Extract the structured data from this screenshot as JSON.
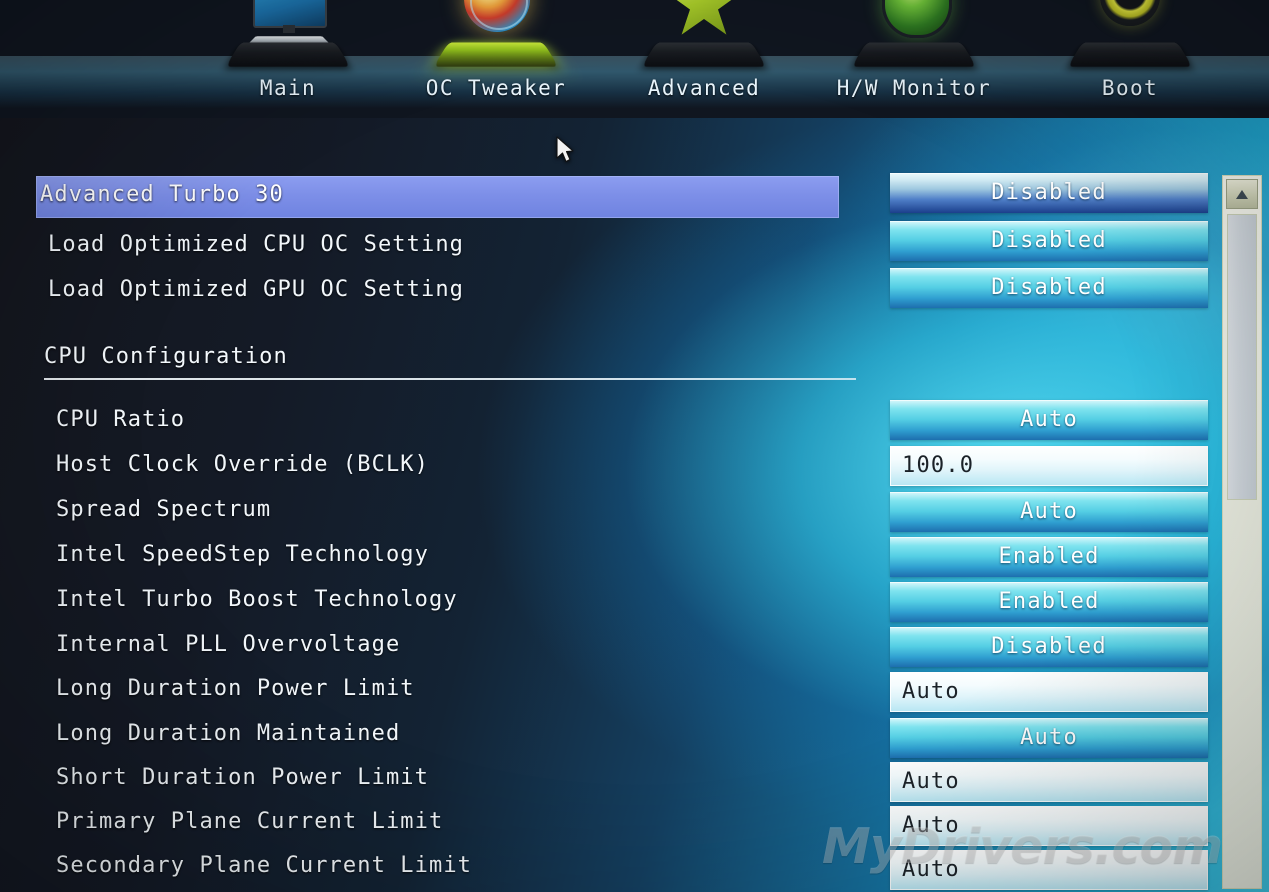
{
  "nav": {
    "tabs": [
      {
        "label": "Main",
        "icon": "monitor-icon",
        "active": false
      },
      {
        "label": "OC Tweaker",
        "icon": "orb-icon",
        "active": true
      },
      {
        "label": "Advanced",
        "icon": "star-icon",
        "active": false
      },
      {
        "label": "H/W Monitor",
        "icon": "gauge-icon",
        "active": false
      },
      {
        "label": "Boot",
        "icon": "power-ring-icon",
        "active": false
      }
    ]
  },
  "settings": [
    {
      "label": "Advanced Turbo 30",
      "value": "Disabled",
      "widget": "dropdown",
      "selected": true,
      "indent": false
    },
    {
      "label": "Load Optimized CPU OC Setting",
      "value": "Disabled",
      "widget": "dropdown",
      "selected": false,
      "indent": false
    },
    {
      "label": "Load Optimized GPU OC Setting",
      "value": "Disabled",
      "widget": "dropdown",
      "selected": false,
      "indent": false
    }
  ],
  "section": {
    "title": "CPU Configuration"
  },
  "cpu_settings": [
    {
      "label": "CPU Ratio",
      "value": "Auto",
      "widget": "dropdown"
    },
    {
      "label": "Host Clock Override (BCLK)",
      "value": "100.0",
      "widget": "input"
    },
    {
      "label": "Spread Spectrum",
      "value": "Auto",
      "widget": "dropdown"
    },
    {
      "label": "Intel SpeedStep Technology",
      "value": "Enabled",
      "widget": "dropdown"
    },
    {
      "label": "Intel Turbo Boost Technology",
      "value": "Enabled",
      "widget": "dropdown"
    },
    {
      "label": "Internal PLL Overvoltage",
      "value": "Disabled",
      "widget": "dropdown"
    },
    {
      "label": "Long Duration Power Limit",
      "value": "Auto",
      "widget": "input"
    },
    {
      "label": "Long Duration Maintained",
      "value": "Auto",
      "widget": "dropdown"
    },
    {
      "label": "Short Duration Power Limit",
      "value": "Auto",
      "widget": "input"
    },
    {
      "label": "Primary Plane Current Limit",
      "value": "Auto",
      "widget": "input"
    },
    {
      "label": "Secondary Plane Current Limit",
      "value": "Auto",
      "widget": "input"
    }
  ],
  "scrollbar": {
    "up_arrow": "scroll-up-arrow"
  },
  "watermark": {
    "text": "MyDrivers.com"
  },
  "colors": {
    "selection_highlight": "#7d8fe8",
    "widget_cyan": "#55cfe4",
    "background_dark": "#14161d",
    "background_cyan": "#3fc4e2",
    "active_tab_glow": "#bdeb3c"
  }
}
